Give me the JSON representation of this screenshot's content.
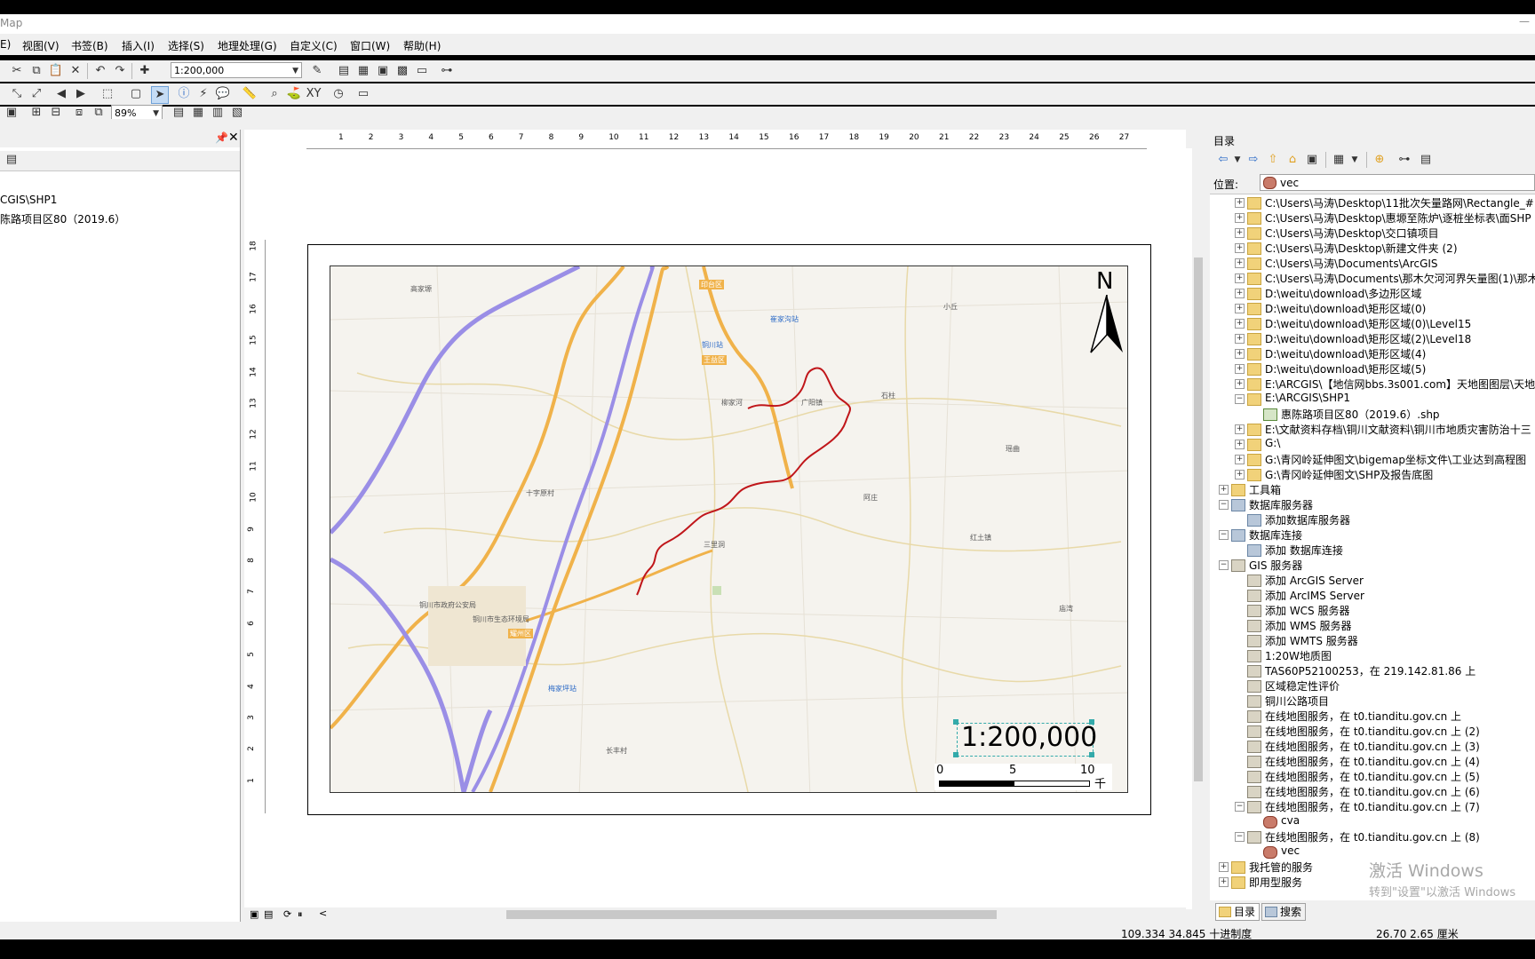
{
  "app": {
    "title_fragment": "Map"
  },
  "menu": [
    "E)",
    "视图(V)",
    "书签(B)",
    "插入(I)",
    "选择(S)",
    "地理处理(G)",
    "自定义(C)",
    "窗口(W)",
    "帮助(H)"
  ],
  "toolbar": {
    "scale_value": "1:200,000",
    "zoom_value": "89%"
  },
  "toc": {
    "items": [
      "CGIS\\SHP1",
      "陈路项目区80（2019.6）"
    ]
  },
  "map": {
    "north_label": "N",
    "scale_text": "1:200,000",
    "scalebar": {
      "labels": [
        "0",
        "5",
        "10"
      ],
      "unit": "千米"
    },
    "ruler_h": [
      "1",
      "2",
      "3",
      "4",
      "5",
      "6",
      "7",
      "8",
      "9",
      "10",
      "11",
      "12",
      "13",
      "14",
      "15",
      "16",
      "17",
      "18",
      "19",
      "20",
      "21",
      "22",
      "23",
      "24",
      "25",
      "26",
      "27"
    ],
    "ruler_v": [
      "18",
      "17",
      "16",
      "15",
      "14",
      "13",
      "12",
      "11",
      "10",
      "9",
      "8",
      "7",
      "6",
      "5",
      "4",
      "3",
      "2",
      "1"
    ],
    "place_labels": [
      "铜川站",
      "王益区",
      "印台区",
      "耀州区",
      "铜川市政府公安局",
      "铜川市生态环境局",
      "梅家坪站",
      "崔家沟站",
      "柳家河",
      "高家塬",
      "三里洞",
      "广阳镇",
      "小丘",
      "阿庄",
      "红土镇",
      "石柱",
      "瑶曲",
      "庙湾",
      "十字原村",
      "长丰村"
    ]
  },
  "catalog": {
    "title": "目录",
    "location_label": "位置:",
    "location_value": "vec",
    "tree": [
      {
        "text": "C:\\Users\\马涛\\Desktop\\11批次矢量路网\\Rectangle_#",
        "level": 1,
        "icon": "folder",
        "exp": "+"
      },
      {
        "text": "C:\\Users\\马涛\\Desktop\\惠塬至陈炉\\逐桩坐标表\\面SHP",
        "level": 1,
        "icon": "folder",
        "exp": "+"
      },
      {
        "text": "C:\\Users\\马涛\\Desktop\\交口镇项目",
        "level": 1,
        "icon": "folder",
        "exp": "+"
      },
      {
        "text": "C:\\Users\\马涛\\Desktop\\新建文件夹 (2)",
        "level": 1,
        "icon": "folder",
        "exp": "+"
      },
      {
        "text": "C:\\Users\\马涛\\Documents\\ArcGIS",
        "level": 1,
        "icon": "folder",
        "exp": "+"
      },
      {
        "text": "C:\\Users\\马涛\\Documents\\那木欠河河界矢量图(1)\\那木",
        "level": 1,
        "icon": "folder",
        "exp": "+"
      },
      {
        "text": "D:\\weitu\\download\\多边形区域",
        "level": 1,
        "icon": "folder",
        "exp": "+"
      },
      {
        "text": "D:\\weitu\\download\\矩形区域(0)",
        "level": 1,
        "icon": "folder",
        "exp": "+"
      },
      {
        "text": "D:\\weitu\\download\\矩形区域(0)\\Level15",
        "level": 1,
        "icon": "folder",
        "exp": "+"
      },
      {
        "text": "D:\\weitu\\download\\矩形区域(2)\\Level18",
        "level": 1,
        "icon": "folder",
        "exp": "+"
      },
      {
        "text": "D:\\weitu\\download\\矩形区域(4)",
        "level": 1,
        "icon": "folder",
        "exp": "+"
      },
      {
        "text": "D:\\weitu\\download\\矩形区域(5)",
        "level": 1,
        "icon": "folder",
        "exp": "+"
      },
      {
        "text": "E:\\ARCGIS\\【地信网bbs.3s001.com】天地图图层\\天地",
        "level": 1,
        "icon": "folder",
        "exp": "+"
      },
      {
        "text": "E:\\ARCGIS\\SHP1",
        "level": 1,
        "icon": "folder",
        "exp": "−"
      },
      {
        "text": "惠陈路项目区80（2019.6）.shp",
        "level": 2,
        "icon": "shp",
        "exp": ""
      },
      {
        "text": "E:\\文献资料存档\\铜川文献资料\\铜川市地质灾害防治十三",
        "level": 1,
        "icon": "folder",
        "exp": "+"
      },
      {
        "text": "G:\\",
        "level": 1,
        "icon": "folder",
        "exp": "+"
      },
      {
        "text": "G:\\青冈岭延伸图文\\bigemap坐标文件\\工业达到高程图",
        "level": 1,
        "icon": "folder",
        "exp": "+"
      },
      {
        "text": "G:\\青冈岭延伸图文\\SHP及报告底图",
        "level": 1,
        "icon": "folder",
        "exp": "+"
      },
      {
        "text": "工具箱",
        "level": 0,
        "icon": "folder",
        "exp": "+"
      },
      {
        "text": "数据库服务器",
        "level": 0,
        "icon": "db",
        "exp": "−"
      },
      {
        "text": "添加数据库服务器",
        "level": 1,
        "icon": "db",
        "exp": ""
      },
      {
        "text": "数据库连接",
        "level": 0,
        "icon": "db",
        "exp": "−"
      },
      {
        "text": "添加 数据库连接",
        "level": 1,
        "icon": "db",
        "exp": ""
      },
      {
        "text": "GIS 服务器",
        "level": 0,
        "icon": "srv",
        "exp": "−"
      },
      {
        "text": "添加 ArcGIS Server",
        "level": 1,
        "icon": "srv",
        "exp": ""
      },
      {
        "text": "添加 ArcIMS Server",
        "level": 1,
        "icon": "srv",
        "exp": ""
      },
      {
        "text": "添加 WCS 服务器",
        "level": 1,
        "icon": "srv",
        "exp": ""
      },
      {
        "text": "添加 WMS 服务器",
        "level": 1,
        "icon": "srv",
        "exp": ""
      },
      {
        "text": "添加 WMTS 服务器",
        "level": 1,
        "icon": "srv",
        "exp": ""
      },
      {
        "text": "1:20W地质图",
        "level": 1,
        "icon": "srv",
        "exp": ""
      },
      {
        "text": "TAS60P52100253，在 219.142.81.86 上",
        "level": 1,
        "icon": "srv",
        "exp": ""
      },
      {
        "text": "区域稳定性评价",
        "level": 1,
        "icon": "srv",
        "exp": ""
      },
      {
        "text": "铜川公路项目",
        "level": 1,
        "icon": "srv",
        "exp": ""
      },
      {
        "text": "在线地图服务，在 t0.tianditu.gov.cn 上",
        "level": 1,
        "icon": "srv",
        "exp": ""
      },
      {
        "text": "在线地图服务，在 t0.tianditu.gov.cn 上 (2)",
        "level": 1,
        "icon": "srv",
        "exp": ""
      },
      {
        "text": "在线地图服务，在 t0.tianditu.gov.cn 上 (3)",
        "level": 1,
        "icon": "srv",
        "exp": ""
      },
      {
        "text": "在线地图服务，在 t0.tianditu.gov.cn 上 (4)",
        "level": 1,
        "icon": "srv",
        "exp": ""
      },
      {
        "text": "在线地图服务，在 t0.tianditu.gov.cn 上 (5)",
        "level": 1,
        "icon": "srv",
        "exp": ""
      },
      {
        "text": "在线地图服务，在 t0.tianditu.gov.cn 上 (6)",
        "level": 1,
        "icon": "srv",
        "exp": ""
      },
      {
        "text": "在线地图服务，在 t0.tianditu.gov.cn 上 (7)",
        "level": 1,
        "icon": "srv",
        "exp": "−"
      },
      {
        "text": "cva",
        "level": 2,
        "icon": "lyr",
        "exp": ""
      },
      {
        "text": "在线地图服务，在 t0.tianditu.gov.cn 上 (8)",
        "level": 1,
        "icon": "srv",
        "exp": "−"
      },
      {
        "text": "vec",
        "level": 2,
        "icon": "lyr",
        "exp": ""
      },
      {
        "text": "我托管的服务",
        "level": 0,
        "icon": "folder",
        "exp": "+"
      },
      {
        "text": "即用型服务",
        "level": 0,
        "icon": "folder",
        "exp": "+"
      }
    ],
    "tabs": [
      "目录",
      "搜索"
    ]
  },
  "status": {
    "coords": "109.334  34.845 十进制度",
    "page_coords": "26.70  2.65 厘米"
  },
  "watermark": {
    "line1": "激活 Windows",
    "line2": "转到\"设置\"以激活 Windows"
  },
  "colors": {
    "route": "#c0161a",
    "highway": "#9a8ee6",
    "road": "#f0b24a",
    "panel": "#f0f0f0"
  }
}
